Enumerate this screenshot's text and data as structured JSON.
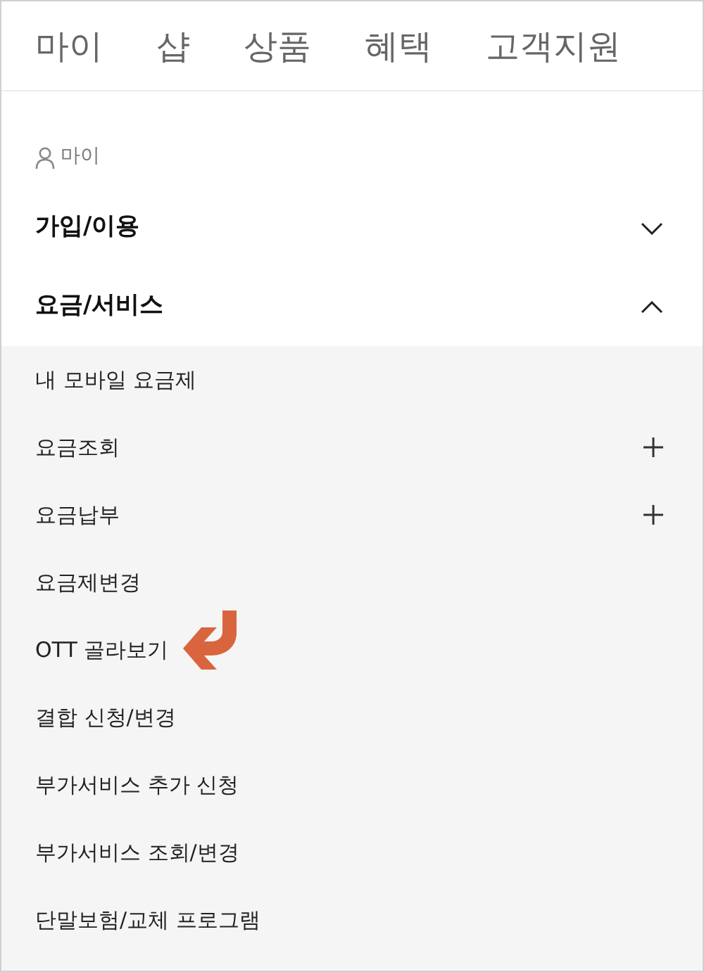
{
  "tabs": [
    {
      "label": "마이"
    },
    {
      "label": "샵"
    },
    {
      "label": "상품"
    },
    {
      "label": "혜택"
    },
    {
      "label": "고객지원"
    }
  ],
  "breadcrumb": {
    "label": "마이"
  },
  "sections": [
    {
      "label": "가입/이용",
      "expanded": false
    },
    {
      "label": "요금/서비스",
      "expanded": true,
      "children": [
        {
          "label": "내 모바일 요금제",
          "expandable": false,
          "marked": false
        },
        {
          "label": "요금조회",
          "expandable": true,
          "marked": false
        },
        {
          "label": "요금납부",
          "expandable": true,
          "marked": false
        },
        {
          "label": "요금제변경",
          "expandable": false,
          "marked": false
        },
        {
          "label": "OTT 골라보기",
          "expandable": false,
          "marked": true
        },
        {
          "label": "결합 신청/변경",
          "expandable": false,
          "marked": false
        },
        {
          "label": "부가서비스 추가 신청",
          "expandable": false,
          "marked": false
        },
        {
          "label": "부가서비스 조회/변경",
          "expandable": false,
          "marked": false
        },
        {
          "label": "단말보험/교체 프로그램",
          "expandable": false,
          "marked": false
        }
      ]
    }
  ]
}
